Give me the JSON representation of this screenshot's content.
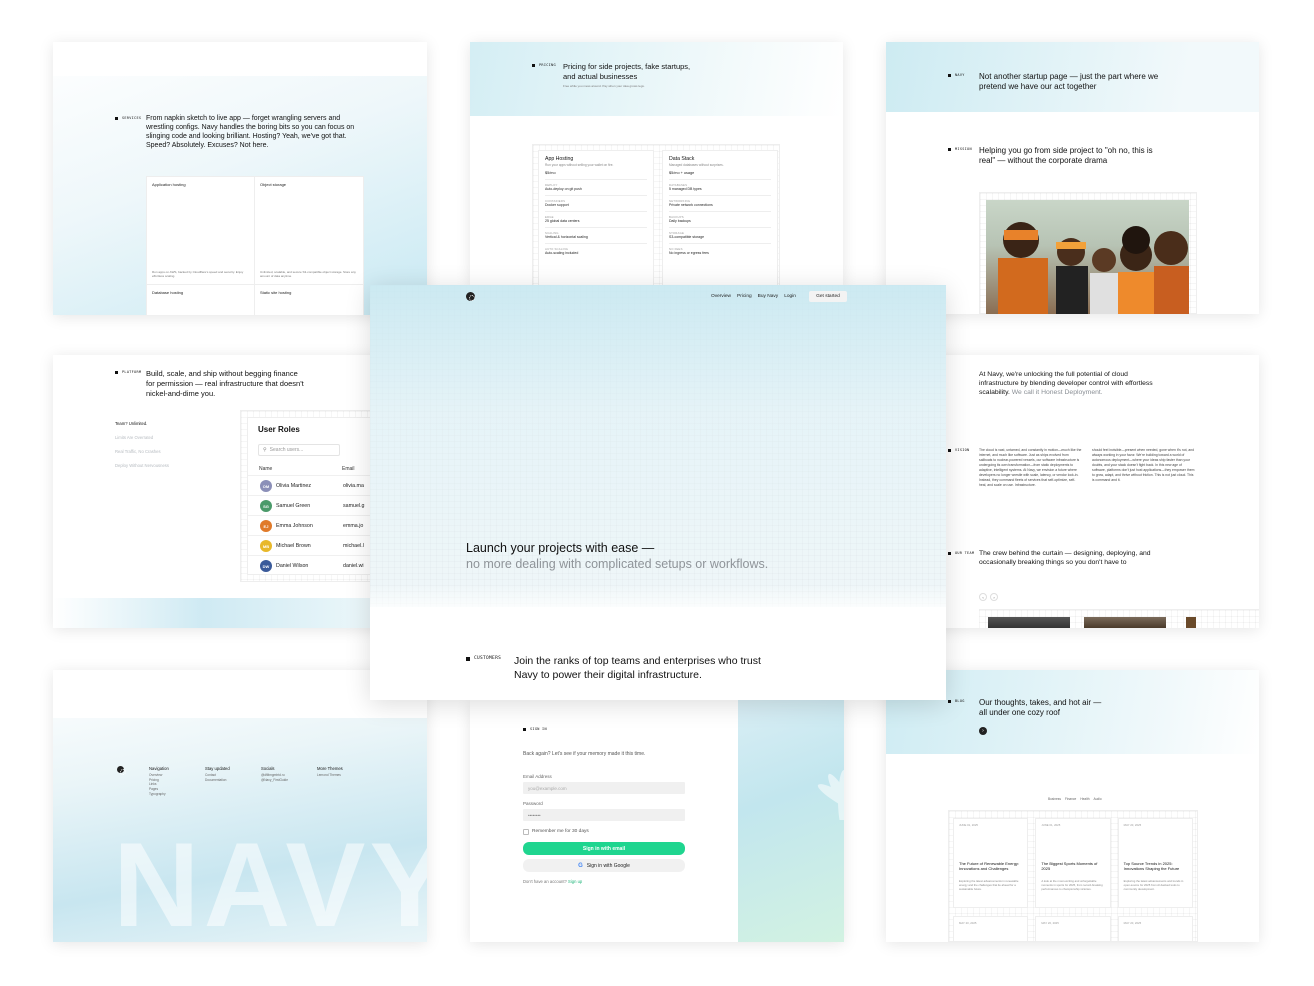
{
  "services": {
    "tag": "SERVICES",
    "text": "From napkin sketch to live app — forget wrangling servers and wrestling configs. Navy handles the boring bits so you can focus on slinging code and looking brilliant. Hosting? Yeah, we've got that. Speed? Absolutely. Excuses? Not here.",
    "cells": [
      {
        "title": "Application hosting",
        "desc": "Run apps on AWS, backed by Cloudflare's speed and security. Enjoy effortless scaling."
      },
      {
        "title": "Object storage",
        "desc": "Unlimited, scalable, and secure S3-compatible object storage. Store any amount of data anytime"
      },
      {
        "title": "Database hosting",
        "desc": ""
      },
      {
        "title": "Static site hosting",
        "desc": ""
      }
    ]
  },
  "pricing": {
    "tag": "PRICING",
    "title": "Pricing for side projects, fake startups, and actual businesses",
    "sub": "Free while you mess around. Pay when your idea grows legs.",
    "plans": [
      {
        "name": "App Hosting",
        "desc": "Run your apps without selling your wallet on fire.",
        "price": "$5/mo",
        "rows": [
          [
            "DEPLOY",
            "Auto-deploy on git push"
          ],
          [
            "CONTAINERS",
            "Docker support"
          ],
          [
            "EDGE",
            "25 global data centers"
          ],
          [
            "SCALING",
            "Vertical & horizontal scaling"
          ],
          [
            "AUTO SCALING",
            "Auto-scaling included"
          ]
        ]
      },
      {
        "name": "Data Stack",
        "desc": "Managed databases without surprises.",
        "price": "$5/mo + usage",
        "rows": [
          [
            "DATABASES",
            "5 managed DB types"
          ],
          [
            "NETWORKING",
            "Private network connections"
          ],
          [
            "BACKUPS",
            "Daily backups"
          ],
          [
            "STORAGE",
            "S3-compatible storage"
          ],
          [
            "NO FEES",
            "No ingress or egress fees"
          ]
        ]
      }
    ]
  },
  "about": {
    "tag1": "NAVY",
    "title1": "Not another startup page — just the part where we pretend we have our act together",
    "tag2": "MISSION",
    "title2": "Helping you go from side project to \"oh no, this is real\" — without the corporate drama"
  },
  "platform": {
    "tag": "PLATFORM",
    "text": "Build, scale, and ship without begging finance for permission — real infrastructure that doesn't nickel-and-dime you.",
    "features": [
      "Team? Unlimited.",
      "Limits Are Overrated",
      "Real Traffic, No Crashes",
      "Deploy Without Nervousness"
    ],
    "roles": {
      "title": "User Roles",
      "search_placeholder": "Search users...",
      "col_name": "Name",
      "col_email": "Email",
      "users": [
        {
          "initials": "OM",
          "name": "Olivia Martinez",
          "email": "olivia.ma",
          "color": "#8b8fb8"
        },
        {
          "initials": "SG",
          "name": "Samuel Green",
          "email": "samuel.g",
          "color": "#4a9a6a"
        },
        {
          "initials": "EJ",
          "name": "Emma Johnson",
          "email": "emma.jo",
          "color": "#e07a2a"
        },
        {
          "initials": "MB",
          "name": "Michael Brown",
          "email": "michael.l",
          "color": "#e8b82a"
        },
        {
          "initials": "DW",
          "name": "Daniel Wilson",
          "email": "daniel.wi",
          "color": "#3a5a9a"
        }
      ]
    }
  },
  "hero": {
    "nav": [
      "Overview",
      "Pricing",
      "Buy Navy",
      "Login"
    ],
    "cta": "Get started",
    "title": "Launch your projects with ease —",
    "subtitle": "no more dealing with complicated setups or workflows.",
    "customers_tag": "CUSTOMERS",
    "customers_text": "Join the ranks of top teams and enterprises who trust Navy to power their digital infrastructure."
  },
  "honest": {
    "title": "At Navy, we're unlocking the full potential of cloud infrastructure by blending developer control with effortless scalability.",
    "title_muted": "We call it Honest Deployment.",
    "vision_tag": "VISION",
    "col1": "The cloud is vast, untamed, and constantly in motion—much like the internet, and much like software. Just as ships evolved from sailboats to nuclear-powered vessels, our software infrastructure is undergoing its own transformation—from static deployments to adaptive, intelligent systems. At Navy, we envision a future where developers no longer wrestle with scale, latency, or vendor lock-in. Instead, they command fleets of services that self-optimize, self-heal, and scale on use. Infrastructure.",
    "col2": "should feel invisible—present when needed, gone when it's not, and always working in your favor. We're building toward a world of autonomous deployment—where your ideas ship faster than your doubts, and your stack doesn't fight back. In this new age of software, platforms don't just host applications—they empower them to grow, adapt, and thrive without friction. This is not just cloud. This is command and it.",
    "team_tag": "OUR TEAM",
    "team_text": "The crew behind the curtain — designing, deploying, and occasionally breaking things so you don't have to"
  },
  "footer": {
    "cols": [
      {
        "title": "Navigation",
        "links": [
          "Overview",
          "Pricing",
          "Links",
          "Pages",
          "Typography"
        ]
      },
      {
        "title": "Stay updated",
        "links": [
          "Contact",
          "Documentation"
        ]
      },
      {
        "title": "Socials",
        "links": [
          "@dfiltmgmtrtd.ru",
          "@Navy_FirstGuide"
        ]
      },
      {
        "title": "More Themes",
        "links": [
          "Lemond Themes"
        ]
      }
    ],
    "watermark": "NAVY"
  },
  "signin": {
    "tag": "SIGN IN",
    "intro": "Back again? Let's see if your memory made it this time.",
    "email_label": "Email Address",
    "email_placeholder": "you@example.com",
    "password_label": "Password",
    "password_value": "••••••••",
    "remember": "Remember me for 30 days",
    "primary": "Sign in with email",
    "google": "Sign in with Google",
    "no_account": "Don't have an account?",
    "signup": "Sign up"
  },
  "blog": {
    "tag": "BLOG",
    "title": "Our thoughts, takes, and hot air — all under one cozy roof",
    "filters": [
      "Business",
      "Finance",
      "Health",
      "Audio"
    ],
    "posts": [
      {
        "date": "JUNE 01, 2025",
        "title": "The Future of Renewable Energy: Innovations and Challenges",
        "desc": "Exploring the latest advancements in renewable energy and the challenges that lie ahead for a sustainable future."
      },
      {
        "date": "JUNE 01, 2025",
        "title": "The Biggest Sports Moments of 2025",
        "desc": "A look at the most exciting and unforgettable moments in sports for 2025, from record-breaking performances to championship victories."
      },
      {
        "date": "MAY 20, 2025",
        "title": "Top Source Trends in 2025: Innovations Shaping the Future",
        "desc": "Exploring the latest advancements and trends in open-source for 2025 from AI-backed tools to community development."
      }
    ],
    "dates2": [
      "MAY 20, 2025",
      "MAY 20, 2025",
      "MAY 20, 2025"
    ]
  },
  "colors": {
    "accent": "#1fd58f",
    "cyan": "#bfe6f0"
  }
}
